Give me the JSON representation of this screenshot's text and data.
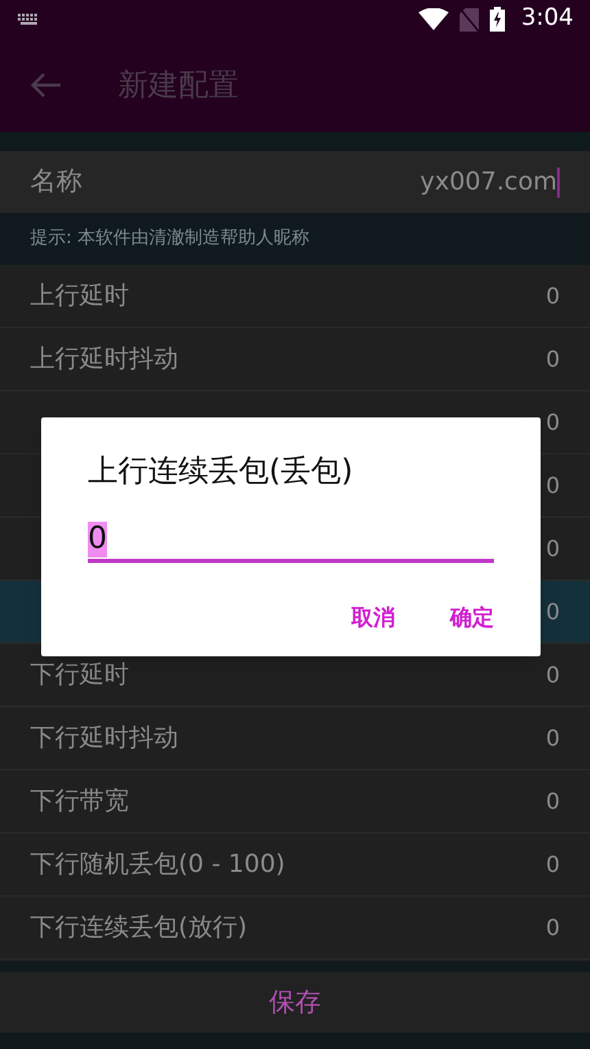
{
  "status_bar": {
    "time": "3:04"
  },
  "app_bar": {
    "title": "新建配置"
  },
  "name_field": {
    "label": "名称",
    "value": "yx007.com"
  },
  "hint": "提示: 本软件由清澈制造帮助人昵称",
  "settings": [
    {
      "label": "上行延时",
      "value": "0",
      "selected": false
    },
    {
      "label": "上行延时抖动",
      "value": "0",
      "selected": false
    },
    {
      "value": "0",
      "selected": false
    },
    {
      "value": "0",
      "selected": false
    },
    {
      "value": "0",
      "selected": false
    },
    {
      "value": "0",
      "selected": true
    },
    {
      "label": "下行延时",
      "value": "0",
      "selected": false
    },
    {
      "label": "下行延时抖动",
      "value": "0",
      "selected": false
    },
    {
      "label": "下行带宽",
      "value": "0",
      "selected": false
    },
    {
      "label": "下行随机丢包(0 - 100)",
      "value": "0",
      "selected": false
    },
    {
      "label": "下行连续丢包(放行)",
      "value": "0",
      "selected": false
    }
  ],
  "save_button": "保存",
  "dialog": {
    "title": "上行连续丢包(丢包)",
    "input": {
      "value": "0",
      "selected": true
    },
    "buttons": [
      "取消",
      "确定"
    ]
  }
}
